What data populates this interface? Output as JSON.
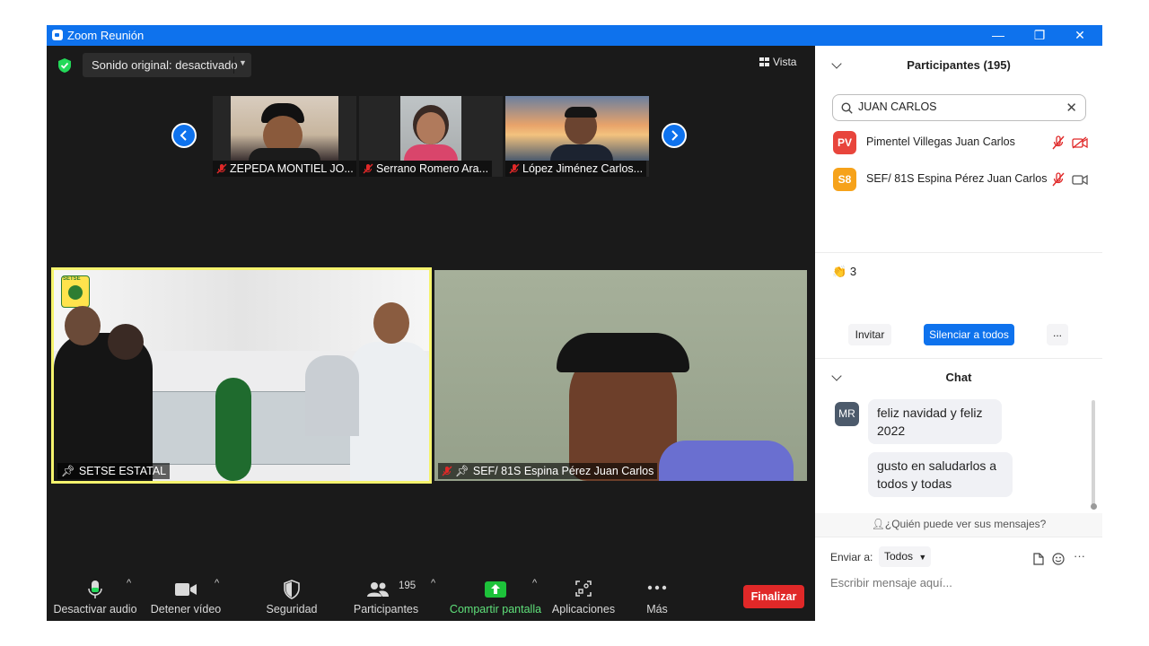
{
  "window": {
    "title": "Zoom Reunión",
    "controls": {
      "minimize": "—",
      "restore": "❐",
      "close": "✕"
    }
  },
  "meeting": {
    "sound_label": "Sonido original: desactivado",
    "view_label": "Vista",
    "thumbnails": [
      {
        "name": "ZEPEDA MONTIEL JO..."
      },
      {
        "name": "Serrano Romero Ara..."
      },
      {
        "name": "López Jiménez Carlos..."
      }
    ],
    "main_tiles": [
      {
        "name": "SETSE ESTATAL",
        "logo_text": "SETSE"
      },
      {
        "name": "SEF/ 81S Espina Pérez Juan Carlos"
      }
    ]
  },
  "toolbar": {
    "audio": "Desactivar audio",
    "video": "Detener vídeo",
    "security": "Seguridad",
    "participants": "Participantes",
    "participant_count": "195",
    "share": "Compartir pantalla",
    "apps": "Aplicaciones",
    "more": "Más",
    "end": "Finalizar"
  },
  "participants_panel": {
    "title": "Participantes (195)",
    "search_value": "JUAN CARLOS",
    "list": [
      {
        "initials": "PV",
        "name": "Pimentel Villegas Juan Carlos",
        "color": "#e8453c"
      },
      {
        "initials": "S8",
        "name": "SEF/ 81S Espina Pérez Juan Carlos",
        "color": "#f6a21a"
      }
    ],
    "reaction_count": "3",
    "invite": "Invitar",
    "mute_all": "Silenciar a todos",
    "more": "..."
  },
  "chat": {
    "title": "Chat",
    "sender_initials": "MR",
    "messages": [
      "feliz navidad y feliz 2022",
      "gusto en saludarlos a todos y todas"
    ],
    "who_can_see": "¿Quién puede ver sus mensajes?",
    "send_to_label": "Enviar a:",
    "send_to_value": "Todos",
    "input_placeholder": "Escribir mensaje aquí..."
  },
  "colors": {
    "accent": "#0e72ed",
    "end_red": "#e02828",
    "share_green": "#1dc23a",
    "active_speaker": "#f5f36d"
  }
}
